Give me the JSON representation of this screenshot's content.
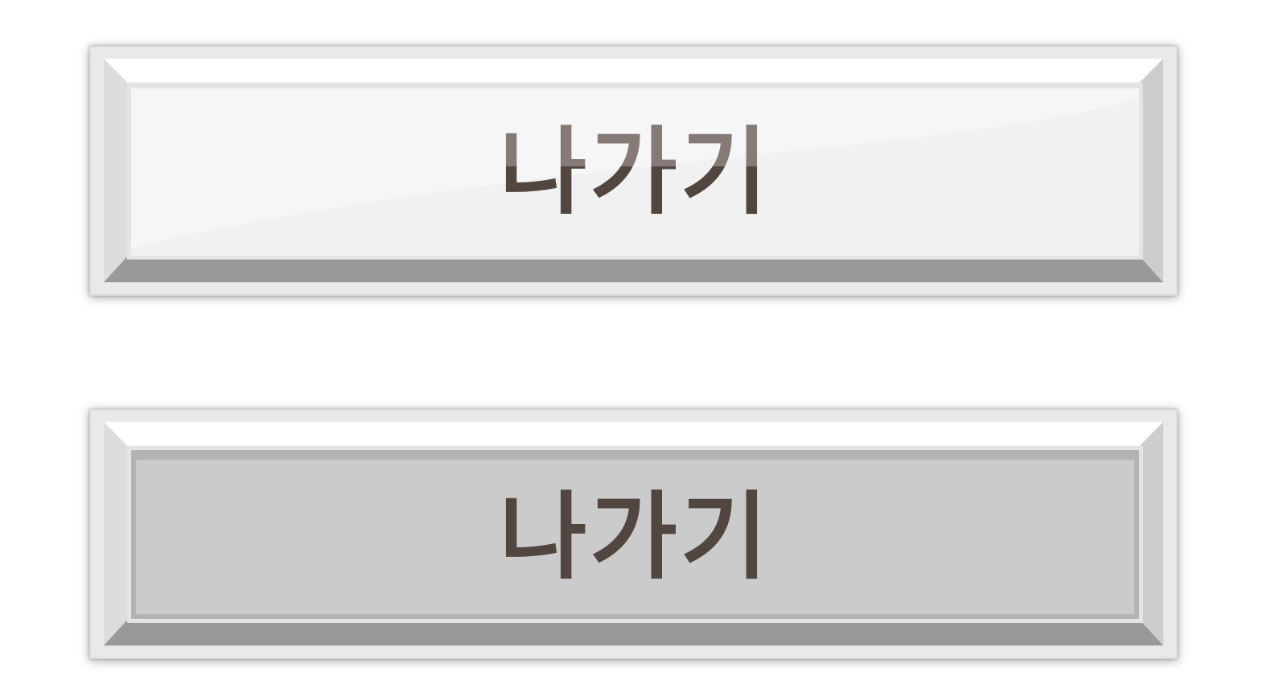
{
  "buttons": {
    "normal": {
      "label": "나가기",
      "state": "normal"
    },
    "pressed": {
      "label": "나가기",
      "state": "pressed"
    }
  },
  "colors": {
    "text": "#514640",
    "text_highlight": "#857a75",
    "face_normal": "#f1f1f1",
    "face_pressed": "#cbcbcb",
    "bevel_light": "#ffffff",
    "bevel_side": "#cfcfcf",
    "bevel_bottom": "#999999"
  }
}
